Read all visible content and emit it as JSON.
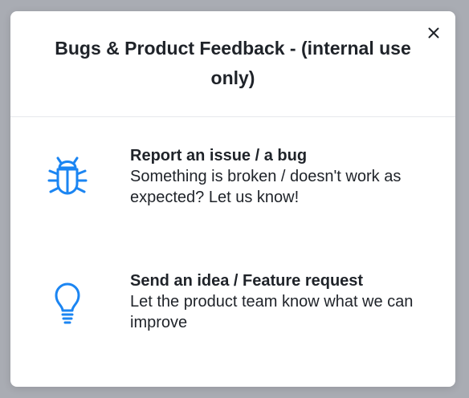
{
  "modal": {
    "title": "Bugs & Product Feedback - (internal use only)",
    "close_icon": "close-icon",
    "options": [
      {
        "icon": "bug-icon",
        "title": "Report an issue / a bug",
        "description": "Something is broken / doesn't work as expected? Let us know!"
      },
      {
        "icon": "lightbulb-icon",
        "title": "Send an idea / Feature request",
        "description": "Let the product team know what we can improve"
      }
    ],
    "accent_color": "#1b85f2"
  }
}
